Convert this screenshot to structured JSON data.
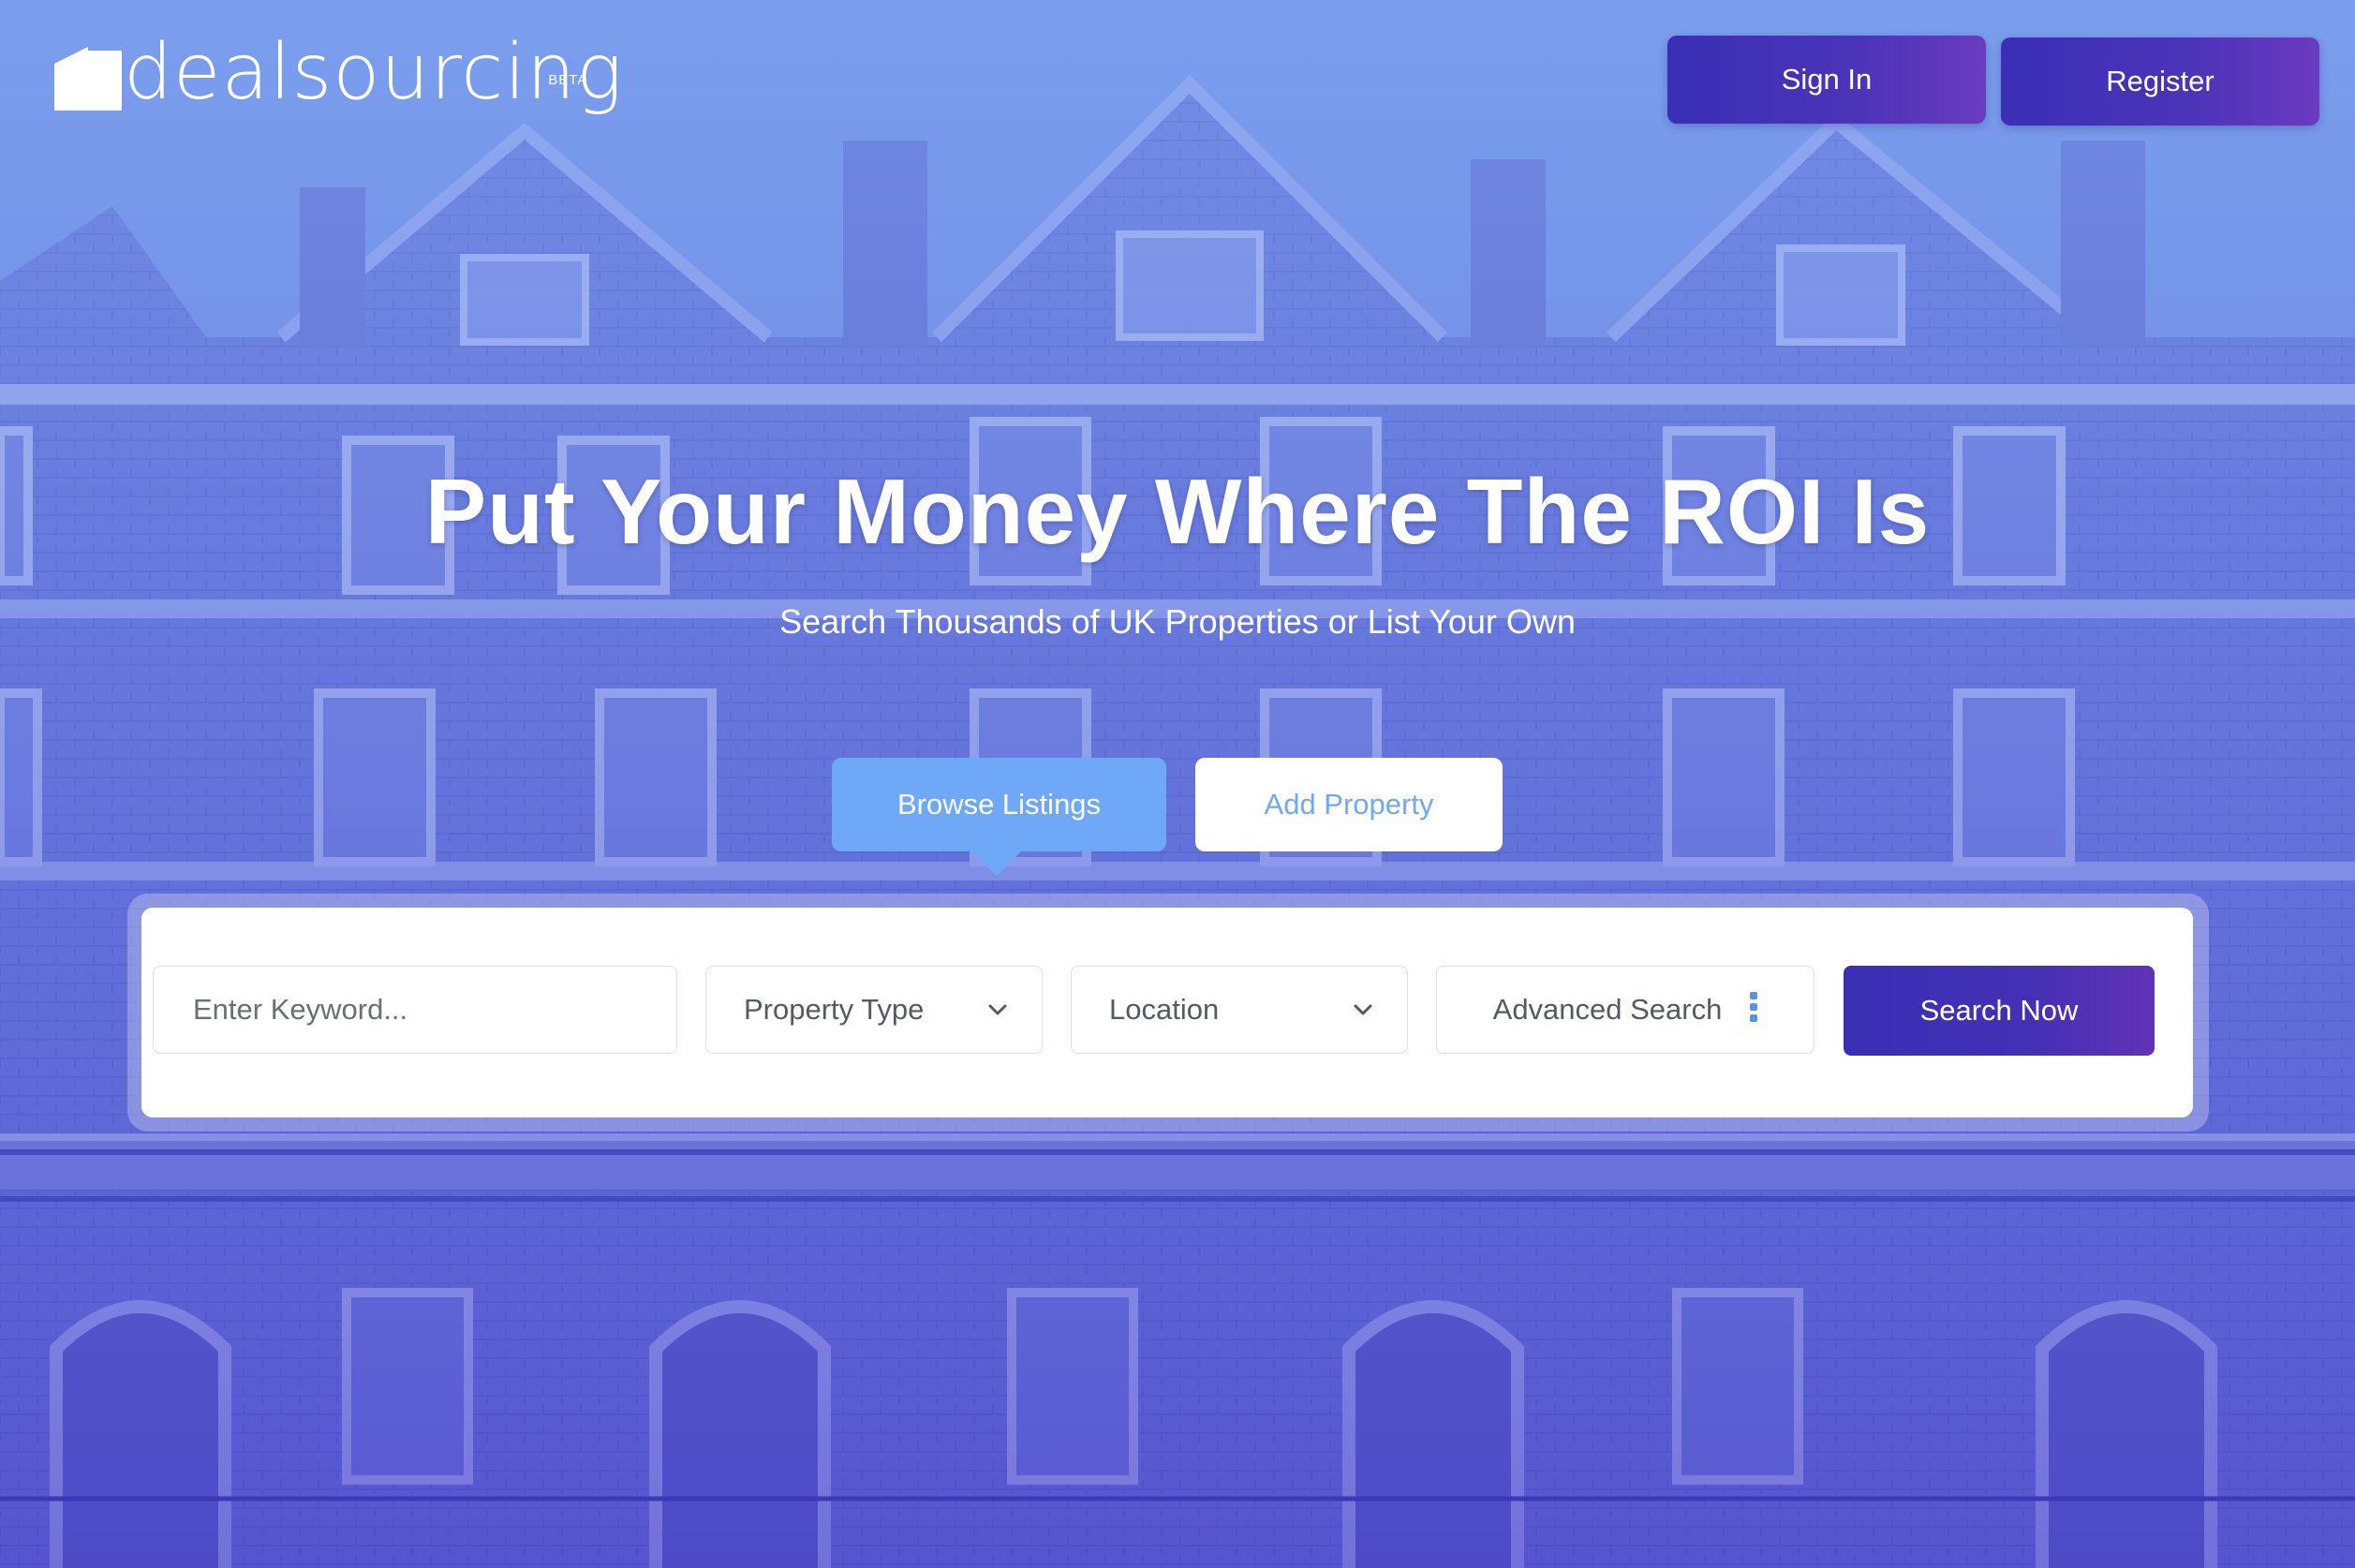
{
  "brand": {
    "name": "dealsourcing",
    "badge": "BETA"
  },
  "header": {
    "signin_label": "Sign In",
    "register_label": "Register"
  },
  "hero": {
    "headline": "Put Your Money Where The ROI Is",
    "subheadline": "Search Thousands of UK Properties or List Your Own"
  },
  "tabs": {
    "browse_label": "Browse Listings",
    "add_label": "Add Property",
    "active": "Browse Listings"
  },
  "search": {
    "keyword_placeholder": "Enter Keyword...",
    "property_type_label": "Property Type",
    "location_label": "Location",
    "advanced_label": "Advanced Search",
    "submit_label": "Search Now"
  },
  "icons": {
    "logo": "house-icon",
    "dropdown": "chevron-down-icon",
    "advanced": "vertical-dots-icon"
  },
  "colors": {
    "primary_gradient_start": "#3a2fb6",
    "primary_gradient_end": "#6a3bbf",
    "accent_light_blue": "#6fa8f7",
    "overlay_top": "#8fb0f0",
    "overlay_bottom": "#5148cc"
  }
}
